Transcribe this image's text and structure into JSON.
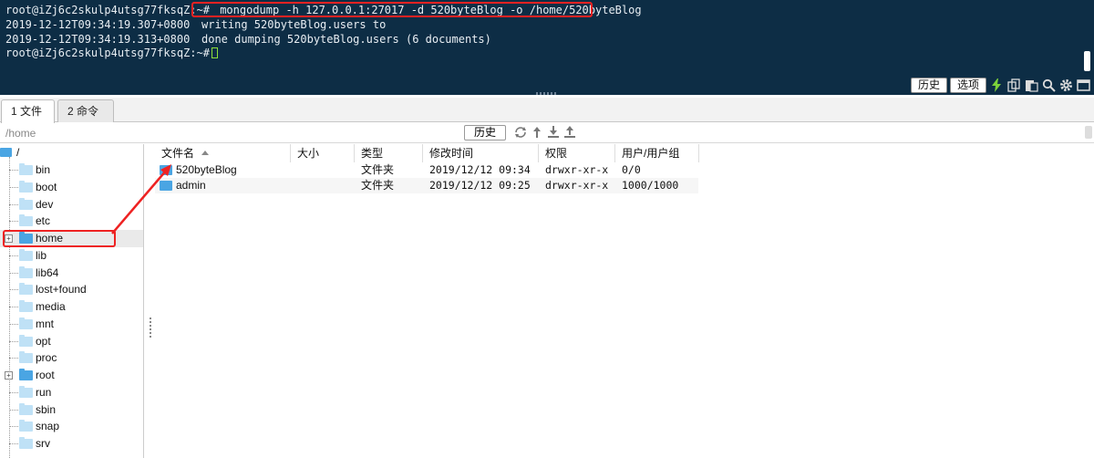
{
  "terminal": {
    "lines": [
      {
        "prompt": "root@iZj6c2skulp4utsg77fksqZ:~#",
        "text": " mongodump -h 127.0.0.1:27017 -d 520byteBlog -o /home/520byteBlog"
      },
      {
        "prompt": "2019-12-12T09:34:19.307+0800",
        "text": "writing 520byteBlog.users to"
      },
      {
        "prompt": "2019-12-12T09:34:19.313+0800",
        "text": "done dumping 520byteBlog.users (6 documents)"
      },
      {
        "prompt": "root@iZj6c2skulp4utsg77fksqZ:~#",
        "text": ""
      }
    ],
    "toolbar": {
      "history_label": "历史",
      "options_label": "选项"
    },
    "highlight_color": "#e22222"
  },
  "tabs": [
    {
      "label": "1 文件",
      "active": true
    },
    {
      "label": "2 命令",
      "active": false
    }
  ],
  "pathbar": {
    "path": "/home",
    "history_label": "历史"
  },
  "tree": {
    "root": "/",
    "items": [
      {
        "label": "bin"
      },
      {
        "label": "boot"
      },
      {
        "label": "dev"
      },
      {
        "label": "etc"
      },
      {
        "label": "home"
      },
      {
        "label": "lib"
      },
      {
        "label": "lib64"
      },
      {
        "label": "lost+found"
      },
      {
        "label": "media"
      },
      {
        "label": "mnt"
      },
      {
        "label": "opt"
      },
      {
        "label": "proc"
      },
      {
        "label": "root"
      },
      {
        "label": "run"
      },
      {
        "label": "sbin"
      },
      {
        "label": "snap"
      },
      {
        "label": "srv"
      }
    ]
  },
  "filelist": {
    "columns": {
      "name": "文件名",
      "size": "大小",
      "type": "类型",
      "mtime": "修改时间",
      "perm": "权限",
      "owner": "用户/用户组"
    },
    "rows": [
      {
        "name": "520byteBlog",
        "size": "",
        "type": "文件夹",
        "mtime": "2019/12/12 09:34",
        "perm": "drwxr-xr-x",
        "owner": "0/0"
      },
      {
        "name": "admin",
        "size": "",
        "type": "文件夹",
        "mtime": "2019/12/12 09:25",
        "perm": "drwxr-xr-x",
        "owner": "1000/1000"
      }
    ]
  }
}
